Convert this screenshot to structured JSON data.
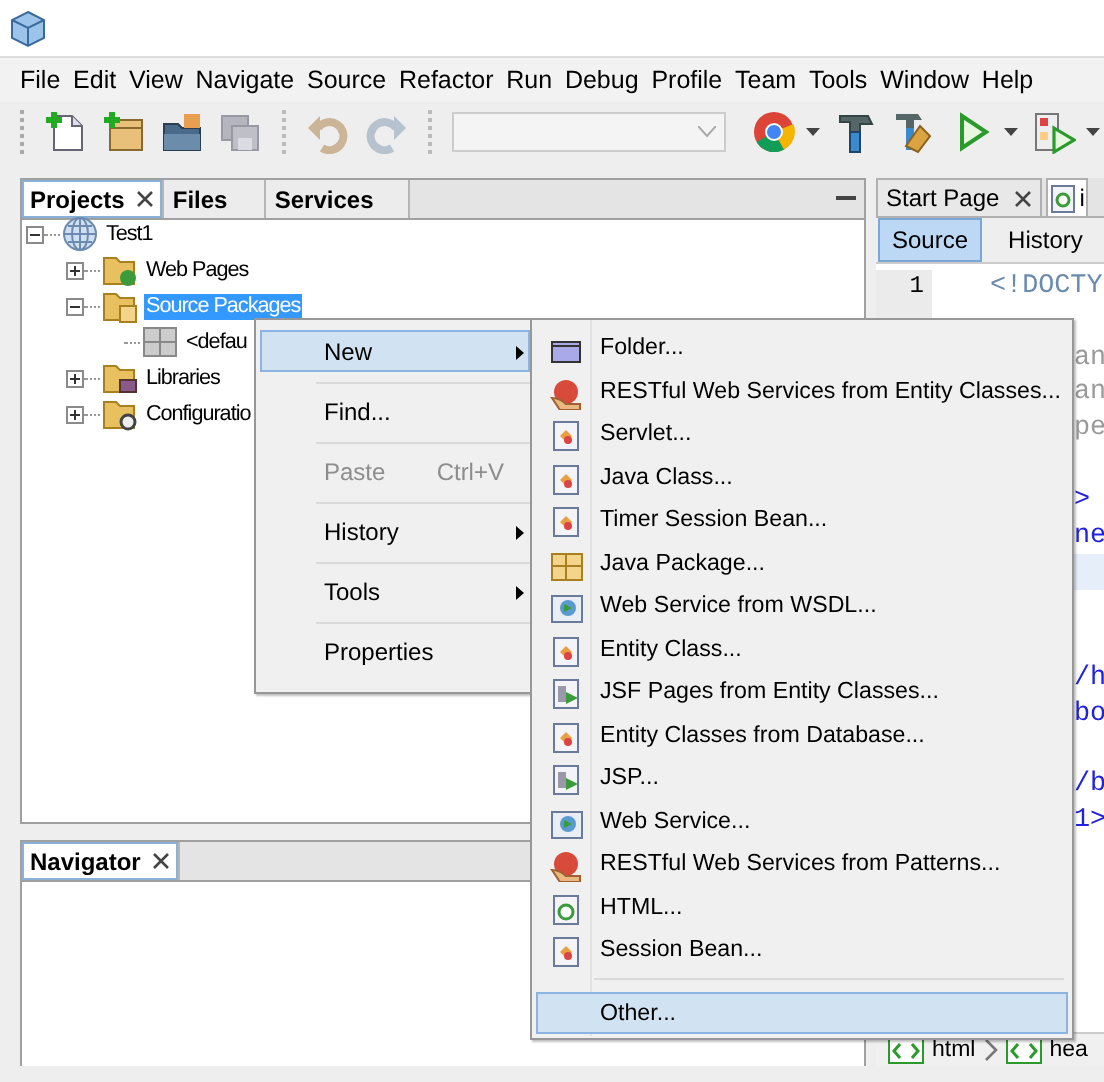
{
  "menu_bar": [
    "File",
    "Edit",
    "View",
    "Navigate",
    "Source",
    "Refactor",
    "Run",
    "Debug",
    "Profile",
    "Team",
    "Tools",
    "Window",
    "Help"
  ],
  "toolbar": {
    "buttons": [
      {
        "kind": "new-file",
        "disabled": false
      },
      {
        "kind": "new-project",
        "disabled": false
      },
      {
        "kind": "open-project",
        "disabled": false
      },
      {
        "kind": "save-all",
        "disabled": true
      },
      {
        "kind": "separator"
      },
      {
        "kind": "undo",
        "disabled": true
      },
      {
        "kind": "redo",
        "disabled": true
      },
      {
        "kind": "separator"
      },
      {
        "kind": "combo",
        "disabled": true
      },
      {
        "kind": "browser",
        "disabled": false,
        "dropdown": true
      },
      {
        "kind": "build",
        "disabled": false
      },
      {
        "kind": "clean-build",
        "disabled": false
      },
      {
        "kind": "run",
        "disabled": false,
        "dropdown": true
      },
      {
        "kind": "debug",
        "disabled": false,
        "dropdown": true
      }
    ]
  },
  "projects_panel": {
    "tabs": [
      {
        "label": "Projects",
        "selected": true,
        "closable": true
      },
      {
        "label": "Files",
        "selected": false
      },
      {
        "label": "Services",
        "selected": false
      }
    ],
    "tree": [
      {
        "label": "Test1",
        "kind": "web-project",
        "expanded": true,
        "selected": false,
        "children": [
          {
            "label": "Web Pages",
            "kind": "web-pages",
            "expanded": false,
            "selected": false
          },
          {
            "label": "Source Packages",
            "kind": "source-packages",
            "expanded": true,
            "selected": true,
            "children": [
              {
                "label": "<defau",
                "kind": "package",
                "selected": false
              }
            ]
          },
          {
            "label": "Libraries",
            "kind": "libraries",
            "expanded": false,
            "selected": false
          },
          {
            "label": "Configuratio",
            "kind": "config-files",
            "expanded": false,
            "selected": false
          }
        ]
      }
    ]
  },
  "navigator_panel": {
    "tabs": [
      {
        "label": "Navigator",
        "selected": true,
        "closable": true
      }
    ]
  },
  "editor": {
    "tabs": [
      {
        "label": "Start Page",
        "selected": false,
        "closable": true
      },
      {
        "label": "i",
        "selected": true
      }
    ],
    "view_tabs": [
      {
        "label": "Source",
        "selected": true
      },
      {
        "label": "History",
        "selected": false
      }
    ],
    "lines": [
      {
        "number": "1",
        "text": "<!DOCTY",
        "kind": "doctype"
      },
      {
        "kind": "blank"
      },
      {
        "text": "an",
        "kind": "comment"
      },
      {
        "text": "an",
        "kind": "comment"
      },
      {
        "text": "pe",
        "kind": "comment"
      },
      {
        "kind": "blank"
      },
      {
        "text": ">",
        "kind": "tag"
      },
      {
        "text": "ne",
        "kind": "tag"
      },
      {
        "kind": "blank",
        "highlighted": true
      },
      {
        "kind": "blank"
      },
      {
        "kind": "blank"
      },
      {
        "text": "/h",
        "kind": "tag"
      },
      {
        "text": "bo",
        "kind": "tag"
      },
      {
        "kind": "blank"
      },
      {
        "text": "/b",
        "kind": "tag"
      },
      {
        "text": "1>",
        "kind": "tag"
      }
    ],
    "breadcrumbs": [
      "html",
      "hea"
    ]
  },
  "context_menu": {
    "items": [
      {
        "label": "New",
        "submenu": true,
        "selected": true,
        "disabled": false
      },
      {
        "label": "Find...",
        "selected": false,
        "disabled": false
      },
      {
        "label": "Paste",
        "shortcut": "Ctrl+V",
        "selected": false,
        "disabled": true
      },
      {
        "label": "History",
        "submenu": true,
        "selected": false,
        "disabled": false
      },
      {
        "label": "Tools",
        "submenu": true,
        "selected": false,
        "disabled": false
      },
      {
        "label": "Properties",
        "selected": false,
        "disabled": false
      }
    ]
  },
  "new_submenu": {
    "items": [
      {
        "label": "Folder...",
        "kind": "folder",
        "selected": false
      },
      {
        "label": "RESTful Web Services from Entity Classes...",
        "kind": "rest",
        "selected": false
      },
      {
        "label": "Servlet...",
        "kind": "class",
        "selected": false
      },
      {
        "label": "Java Class...",
        "kind": "class",
        "selected": false
      },
      {
        "label": "Timer Session Bean...",
        "kind": "class",
        "selected": false
      },
      {
        "label": "Java Package...",
        "kind": "package",
        "selected": false
      },
      {
        "label": "Web Service from WSDL...",
        "kind": "web-service",
        "selected": false
      },
      {
        "label": "Entity Class...",
        "kind": "class",
        "selected": false
      },
      {
        "label": "JSF Pages from Entity Classes...",
        "kind": "jsf",
        "selected": false
      },
      {
        "label": "Entity Classes from Database...",
        "kind": "class",
        "selected": false
      },
      {
        "label": "JSP...",
        "kind": "jsf",
        "selected": false
      },
      {
        "label": "Web Service...",
        "kind": "web-service",
        "selected": false
      },
      {
        "label": "RESTful Web Services from Patterns...",
        "kind": "rest",
        "selected": false
      },
      {
        "label": "HTML...",
        "kind": "html",
        "selected": false
      },
      {
        "label": "Session Bean...",
        "kind": "class",
        "selected": false
      },
      {
        "kind": "separator"
      },
      {
        "label": "Other...",
        "kind": "plain",
        "selected": true
      }
    ]
  }
}
